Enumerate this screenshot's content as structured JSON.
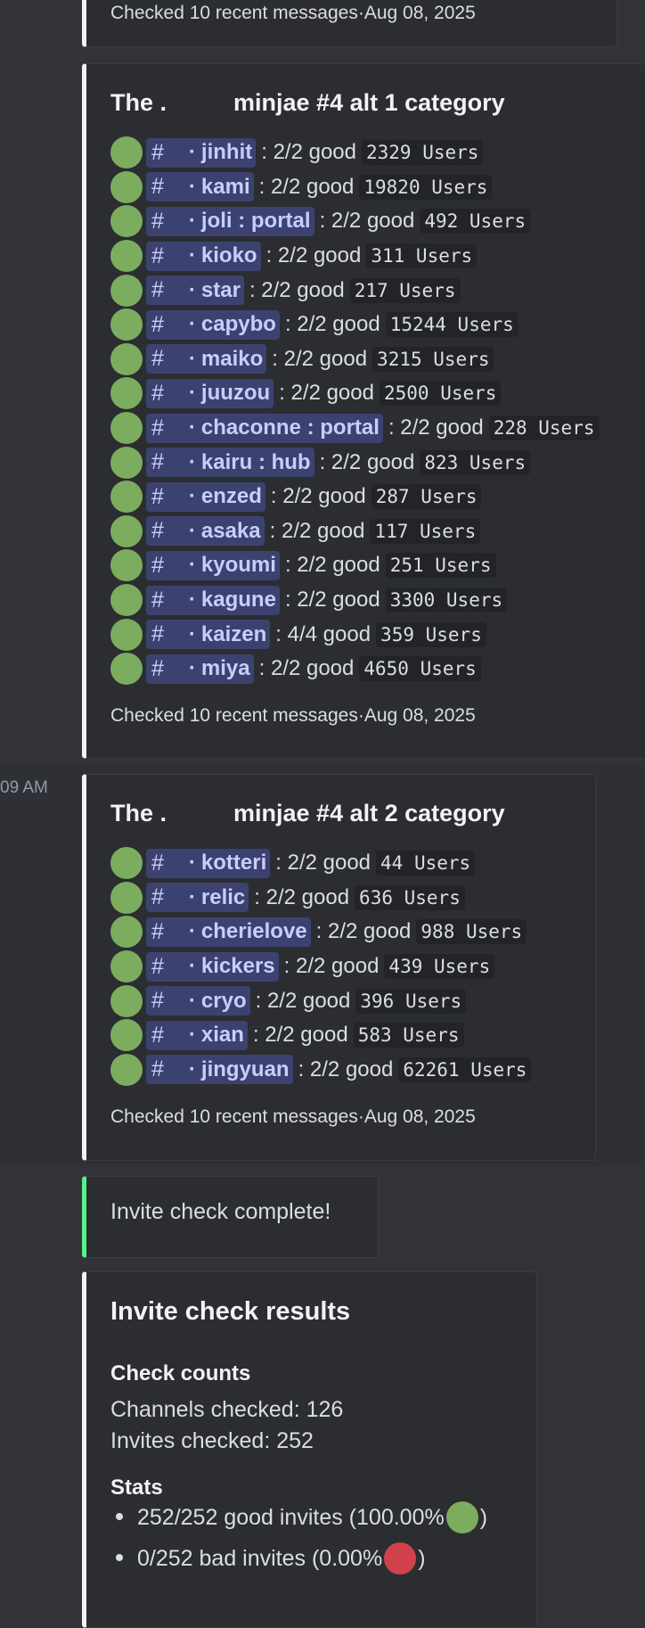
{
  "top_footer": "Checked 10 recent messages·Aug 08, 2025",
  "timestamp": "09 AM",
  "embed1": {
    "title_prefix": "The .",
    "title_suffix": "minjae #4 alt 1 category",
    "footer": "Checked 10 recent messages·Aug 08, 2025",
    "rows": [
      {
        "name": "jinhit",
        "status": ": 2/2 good",
        "users": "2329 Users"
      },
      {
        "name": "kami",
        "status": ": 2/2 good",
        "users": "19820 Users"
      },
      {
        "name": "joli : portal",
        "status": ": 2/2 good",
        "users": "492 Users"
      },
      {
        "name": "kioko",
        "status": ": 2/2 good",
        "users": "311 Users"
      },
      {
        "name": "star",
        "status": ": 2/2 good",
        "users": "217 Users"
      },
      {
        "name": "capybo",
        "status": ": 2/2 good",
        "users": "15244 Users"
      },
      {
        "name": "maiko",
        "status": ": 2/2 good",
        "users": "3215 Users"
      },
      {
        "name": "juuzou",
        "status": ": 2/2 good",
        "users": "2500 Users"
      },
      {
        "name": "chaconne : portal",
        "status": ": 2/2 good",
        "users": "228 Users"
      },
      {
        "name": "kairu : hub",
        "status": ": 2/2 good",
        "users": "823 Users"
      },
      {
        "name": "enzed",
        "status": ": 2/2 good",
        "users": "287 Users"
      },
      {
        "name": "asaka",
        "status": ": 2/2 good",
        "users": "117 Users"
      },
      {
        "name": "kyoumi",
        "status": ": 2/2 good",
        "users": "251 Users"
      },
      {
        "name": "kagune",
        "status": ": 2/2 good",
        "users": "3300 Users"
      },
      {
        "name": "kaizen",
        "status": ": 4/4 good",
        "users": "359 Users"
      },
      {
        "name": "miya",
        "status": ": 2/2 good",
        "users": "4650 Users"
      }
    ]
  },
  "embed2": {
    "title_prefix": "The .",
    "title_suffix": "minjae #4 alt 2 category",
    "footer": "Checked 10 recent messages·Aug 08, 2025",
    "rows": [
      {
        "name": "kotteri",
        "status": ": 2/2 good",
        "users": "44 Users"
      },
      {
        "name": "relic",
        "status": ": 2/2 good",
        "users": "636 Users"
      },
      {
        "name": "cherielove",
        "status": ": 2/2 good",
        "users": "988 Users"
      },
      {
        "name": "kickers",
        "status": ": 2/2 good",
        "users": "439 Users"
      },
      {
        "name": "cryo",
        "status": ": 2/2 good",
        "users": "396 Users"
      },
      {
        "name": "xian",
        "status": ": 2/2 good",
        "users": "583 Users"
      },
      {
        "name": "jingyuan",
        "status": ": 2/2 good",
        "users": "62261 Users"
      }
    ]
  },
  "complete_text": "Invite check complete!",
  "results": {
    "title": "Invite check results",
    "counts_heading": "Check counts",
    "channels_checked": "Channels checked: 126",
    "invites_checked": "Invites checked: 252",
    "stats_heading": "Stats",
    "good_text": "252/252 good invites (100.00%",
    "bad_text": "0/252 bad invites (0.00%",
    "close_paren": ")"
  },
  "hash_symbol": "#",
  "separator": "·",
  "colors": {
    "good": "#7cac5e",
    "bad": "#d0424b",
    "accent_green": "#57f287",
    "embed_border": "#f2f3f5"
  }
}
